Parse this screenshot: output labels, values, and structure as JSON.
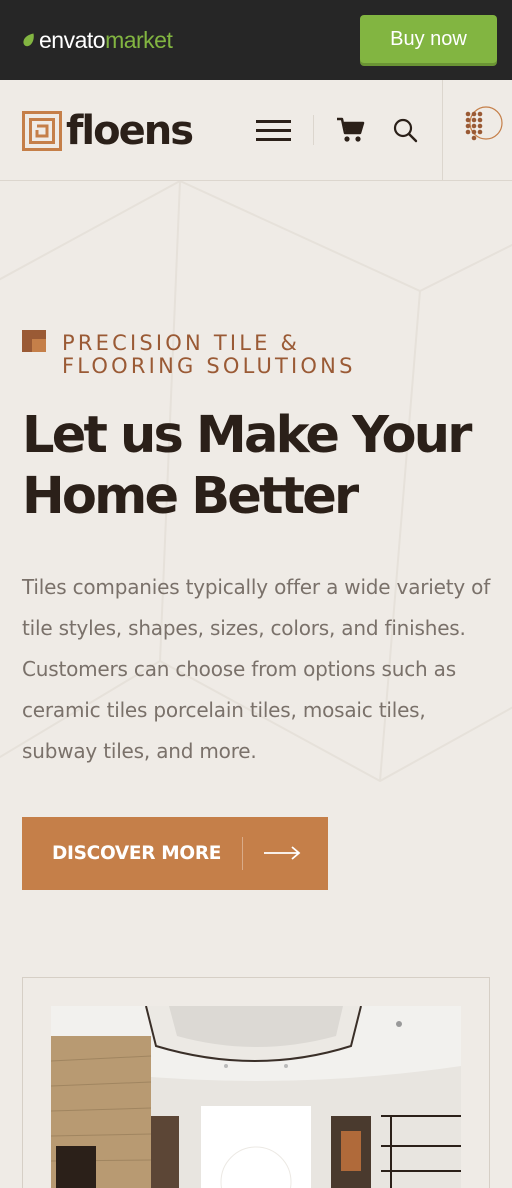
{
  "envato": {
    "logo_word": "envato",
    "logo_market": "market",
    "buy_label": "Buy now",
    "brand_green": "#82b541"
  },
  "header": {
    "logo_text": "floens",
    "icons": [
      "menu-icon",
      "cart-icon",
      "search-icon",
      "dots-grid-icon"
    ]
  },
  "hero": {
    "tagline_line1": "PRECISION TILE &",
    "tagline_line2": "FLOORING SOLUTIONS",
    "headline_line1": "Let us Make Your",
    "headline_line2": "Home Better",
    "description": "Tiles companies typically offer a wide variety of tile styles, shapes, sizes, colors, and finishes. Customers can choose from options such as ceramic tiles porcelain tiles, mosaic tiles, subway tiles, and more.",
    "cta_label": "DISCOVER MORE"
  },
  "colors": {
    "accent": "#c57f49",
    "dark": "#2b2019",
    "background": "#efebe6",
    "tagline": "#9a5a35"
  }
}
